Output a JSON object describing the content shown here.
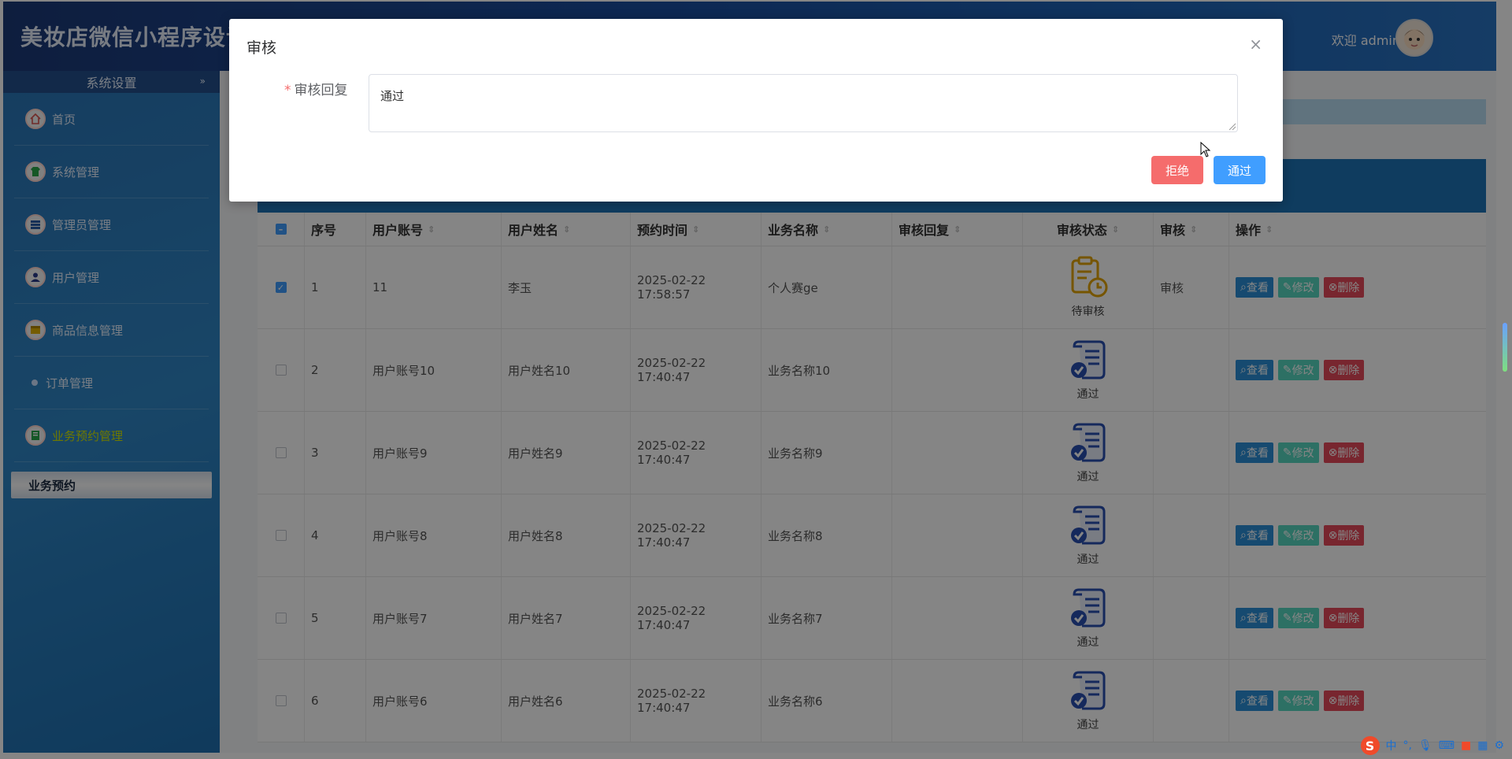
{
  "header": {
    "app_title": "美妆店微信小程序设计",
    "welcome": "欢迎 admin"
  },
  "sidebar": {
    "section_title": "系统设置",
    "items": [
      {
        "label": "首页",
        "icon": "home-icon"
      },
      {
        "label": "系统管理",
        "icon": "shirt-icon"
      },
      {
        "label": "管理员管理",
        "icon": "list-icon"
      },
      {
        "label": "用户管理",
        "icon": "user-icon"
      },
      {
        "label": "商品信息管理",
        "icon": "box-icon"
      },
      {
        "label": "订单管理",
        "icon": "dot-icon"
      },
      {
        "label": "业务预约管理",
        "icon": "book-icon"
      }
    ],
    "active_sub": "业务预约"
  },
  "table": {
    "columns": [
      "序号",
      "用户账号",
      "用户姓名",
      "预约时间",
      "业务名称",
      "审核回复",
      "审核状态",
      "审核",
      "操作"
    ],
    "rows": [
      {
        "idx": "1",
        "account": "11",
        "name": "李玉",
        "time": "2025-02-22 17:58:57",
        "business": "个人赛ge",
        "reply": "",
        "status": "待审核",
        "audit": "审核",
        "checked": true
      },
      {
        "idx": "2",
        "account": "用户账号10",
        "name": "用户姓名10",
        "time": "2025-02-22 17:40:47",
        "business": "业务名称10",
        "reply": "",
        "status": "通过",
        "audit": "",
        "checked": false
      },
      {
        "idx": "3",
        "account": "用户账号9",
        "name": "用户姓名9",
        "time": "2025-02-22 17:40:47",
        "business": "业务名称9",
        "reply": "",
        "status": "通过",
        "audit": "",
        "checked": false
      },
      {
        "idx": "4",
        "account": "用户账号8",
        "name": "用户姓名8",
        "time": "2025-02-22 17:40:47",
        "business": "业务名称8",
        "reply": "",
        "status": "通过",
        "audit": "",
        "checked": false
      },
      {
        "idx": "5",
        "account": "用户账号7",
        "name": "用户姓名7",
        "time": "2025-02-22 17:40:47",
        "business": "业务名称7",
        "reply": "",
        "status": "通过",
        "audit": "",
        "checked": false
      },
      {
        "idx": "6",
        "account": "用户账号6",
        "name": "用户姓名6",
        "time": "2025-02-22 17:40:47",
        "business": "业务名称6",
        "reply": "",
        "status": "通过",
        "audit": "",
        "checked": false
      }
    ],
    "actions": {
      "view": "查看",
      "edit": "修改",
      "delete": "删除"
    }
  },
  "dialog": {
    "title": "审核",
    "field_label": "审核回复",
    "field_value": "通过",
    "reject": "拒绝",
    "approve": "通过"
  },
  "tray": {
    "ime": "中"
  },
  "colors": {
    "primary": "#409eff",
    "danger": "#f56c6c",
    "header": "#1a4ea0",
    "sidebar": "#2f86c6"
  }
}
